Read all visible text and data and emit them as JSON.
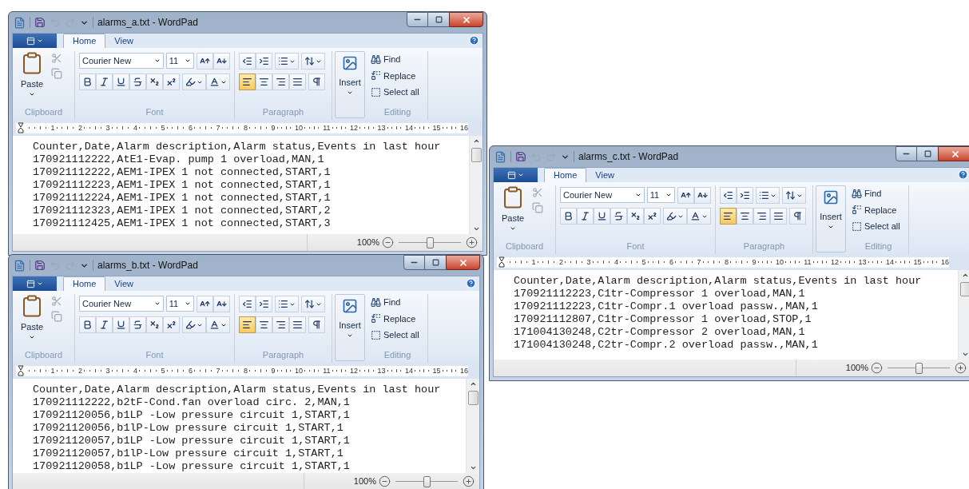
{
  "windows": [
    {
      "title": "alarms_a.txt - WordPad",
      "tabs": [
        {
          "label": "Home",
          "selected": true
        },
        {
          "label": "View",
          "selected": false
        }
      ],
      "ribbon": {
        "paste": "Paste",
        "font_name": "Courier New",
        "font_size": "11",
        "alignment": [
          {
            "kind": "left",
            "selected": true
          },
          {
            "kind": "center",
            "selected": false
          },
          {
            "kind": "right",
            "selected": false
          },
          {
            "kind": "justify",
            "selected": false
          }
        ],
        "insert": "Insert",
        "editing": [
          {
            "kind": "find",
            "label": "Find"
          },
          {
            "kind": "replace",
            "label": "Replace"
          },
          {
            "kind": "select",
            "label": "Select all"
          }
        ],
        "groups": [
          "Clipboard",
          "Font",
          "Paragraph",
          "Editing"
        ]
      },
      "ruler": [
        "1",
        "2",
        "3",
        "4",
        "5",
        "6",
        "7",
        "8",
        "9",
        "10",
        "11",
        "12",
        "13",
        "14",
        "15",
        "16"
      ],
      "lines": [
        "Counter,Date,Alarm description,Alarm status,Events in last hour",
        "170921112222,AtE1-Evap. pump 1 overload,MAN,1",
        "170921112222,AEM1-IPEX 1 not connected,START,1",
        "170921112223,AEM1-IPEX 1 not connected,START,1",
        "170921112224,AEM1-IPEX 1 not connected,START,1",
        "170921112323,AEM1-IPEX 1 not connected,START,2",
        "170921112425,AEM1-IPEX 1 not connected,START,3"
      ],
      "zoom": {
        "reading": "100%",
        "level": 0.5
      }
    },
    {
      "title": "alarms_b.txt - WordPad",
      "tabs": [
        {
          "label": "Home",
          "selected": true
        },
        {
          "label": "View",
          "selected": false
        }
      ],
      "ribbon": {
        "paste": "Paste",
        "font_name": "Courier New",
        "font_size": "11",
        "alignment": [
          {
            "kind": "left",
            "selected": true
          },
          {
            "kind": "center",
            "selected": false
          },
          {
            "kind": "right",
            "selected": false
          },
          {
            "kind": "justify",
            "selected": false
          }
        ],
        "insert": "Insert",
        "editing": [
          {
            "kind": "find",
            "label": "Find"
          },
          {
            "kind": "replace",
            "label": "Replace"
          },
          {
            "kind": "select",
            "label": "Select all"
          }
        ],
        "groups": [
          "Clipboard",
          "Font",
          "Paragraph",
          "Editing"
        ]
      },
      "ruler": [
        "1",
        "2",
        "3",
        "4",
        "5",
        "6",
        "7",
        "8",
        "9",
        "10",
        "11",
        "12",
        "13",
        "14",
        "15",
        "16"
      ],
      "lines": [
        "Counter,Date,Alarm description,Alarm status,Events in last hour",
        "170921112222,b2tF-Cond.fan overload circ. 2,MAN,1",
        "170921120056,b1LP -Low pressure circuit 1,START,1",
        "170921120056,b1lP-Low pressure circuit 1,START,1",
        "170921120057,b1LP -Low pressure circuit 1,START,1",
        "170921120057,b1lP-Low pressure circuit 1,START,1",
        "170921120058,b1LP -Low pressure circuit 1,START,1"
      ],
      "zoom": {
        "reading": "100%",
        "level": 0.5
      }
    },
    {
      "title": "alarms_c.txt - WordPad",
      "tabs": [
        {
          "label": "Home",
          "selected": true
        },
        {
          "label": "View",
          "selected": false
        }
      ],
      "ribbon": {
        "paste": "Paste",
        "font_name": "Courier New",
        "font_size": "11",
        "alignment": [
          {
            "kind": "left",
            "selected": true
          },
          {
            "kind": "center",
            "selected": false
          },
          {
            "kind": "right",
            "selected": false
          },
          {
            "kind": "justify",
            "selected": false
          }
        ],
        "insert": "Insert",
        "editing": [
          {
            "kind": "find",
            "label": "Find"
          },
          {
            "kind": "replace",
            "label": "Replace"
          },
          {
            "kind": "select",
            "label": "Select all"
          }
        ],
        "groups": [
          "Clipboard",
          "Font",
          "Paragraph",
          "Editing"
        ]
      },
      "ruler": [
        "1",
        "2",
        "3",
        "4",
        "5",
        "6",
        "7",
        "8",
        "9",
        "10",
        "11",
        "12",
        "13",
        "14",
        "15",
        "16"
      ],
      "lines": [
        "Counter,Date,Alarm description,Alarm status,Events in last hour",
        "170921112223,C1tr-Compressor 1 overload,MAN,1",
        "170921112223,C1tr-Compr.1 overload passw.,MAN,1",
        "170921112807,C1tr-Compressor 1 overload,STOP,1",
        "171004130248,C2tr-Compressor 2 overload,MAN,1",
        "171004130248,C2tr-Compr.2 overload passw.,MAN,1"
      ],
      "zoom": {
        "reading": "100%",
        "level": 0.5
      }
    }
  ]
}
